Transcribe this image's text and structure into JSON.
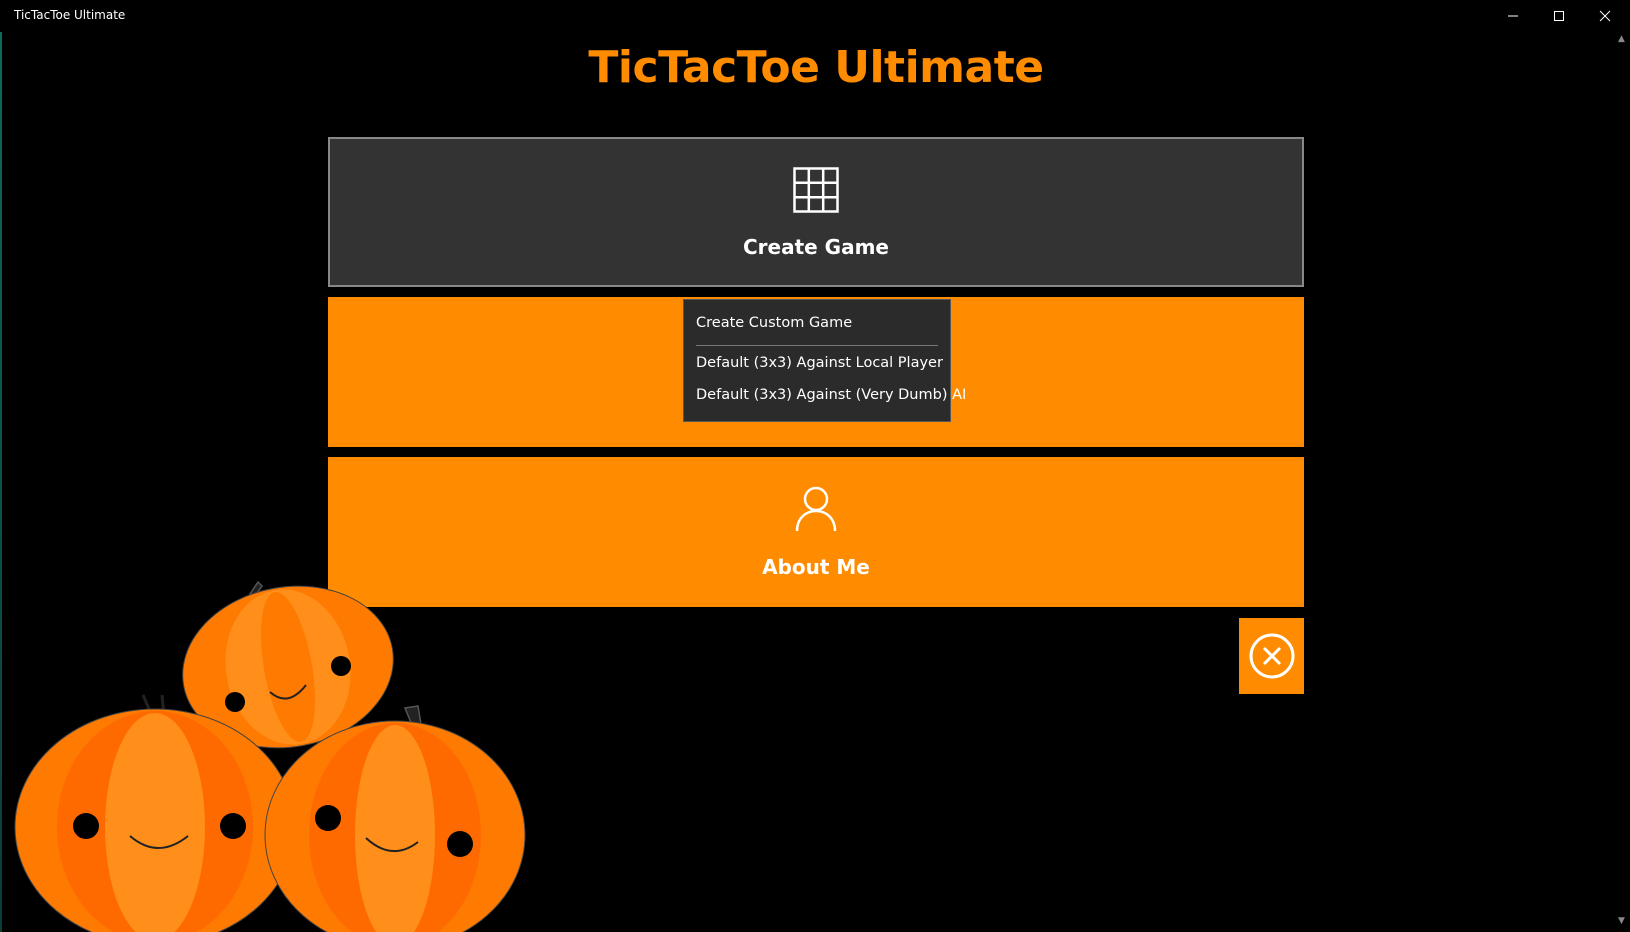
{
  "window": {
    "title": "TicTacToe Ultimate",
    "controls": [
      "minimize-icon",
      "maximize-icon",
      "close-icon"
    ]
  },
  "header": {
    "title": "TicTacToe Ultimate"
  },
  "tiles": {
    "create_game": {
      "label": "Create Game",
      "icon": "grid-icon"
    },
    "about_me": {
      "label": "About Me",
      "icon": "person-icon"
    }
  },
  "flyout": {
    "items": [
      "Create Custom Game",
      "Default (3x3) Against Local Player",
      "Default (3x3) Against (Very Dumb) AI"
    ]
  },
  "close_button": {
    "icon": "circle-x-icon"
  },
  "decoration": {
    "image": "pumpkins"
  },
  "colors": {
    "accent": "#ff8b00",
    "tile_dark": "#333333",
    "background": "#000000",
    "flyout_bg": "#2b2b2b"
  }
}
